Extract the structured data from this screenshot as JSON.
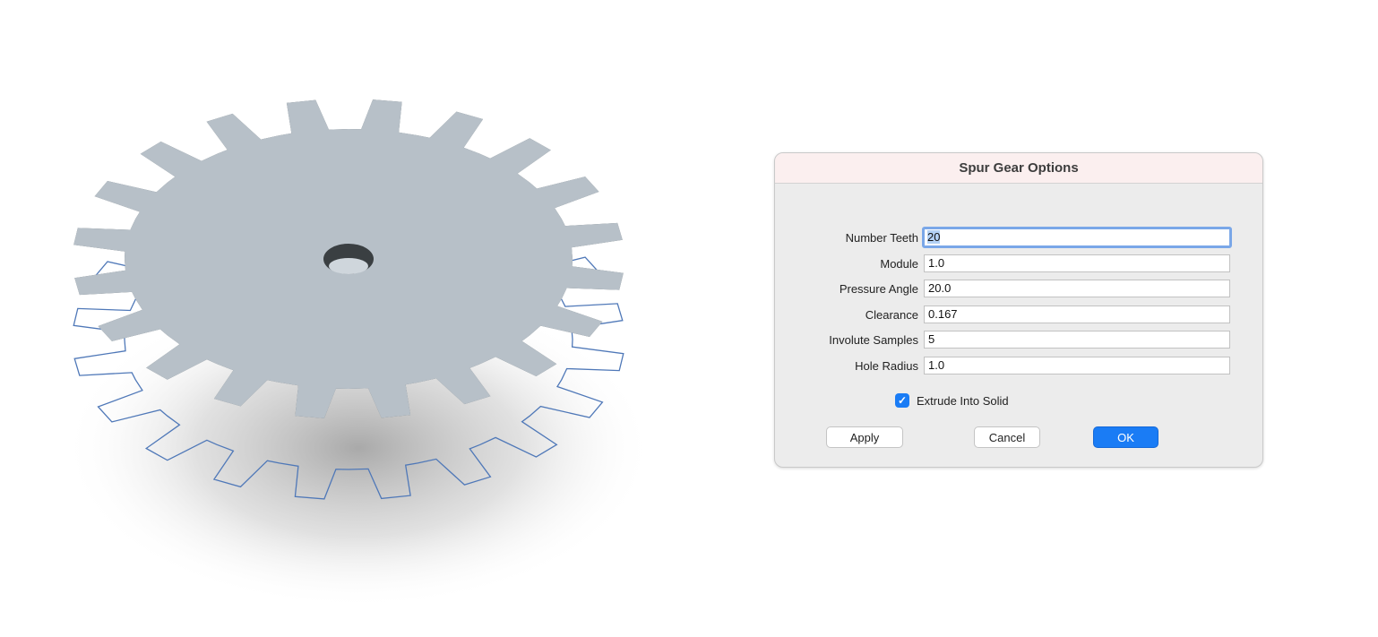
{
  "dialog": {
    "title": "Spur Gear Options",
    "fields": [
      {
        "label": "Number Teeth",
        "value": "20"
      },
      {
        "label": "Module",
        "value": "1.0"
      },
      {
        "label": "Pressure Angle",
        "value": "20.0"
      },
      {
        "label": "Clearance",
        "value": "0.167"
      },
      {
        "label": "Involute Samples",
        "value": "5"
      },
      {
        "label": "Hole Radius",
        "value": "1.0"
      }
    ],
    "extrude": {
      "label": "Extrude Into Solid",
      "checked": true
    },
    "buttons": {
      "apply": "Apply",
      "cancel": "Cancel",
      "ok": "OK"
    }
  },
  "viewport": {
    "gear_teeth": 20,
    "gear_color": "#b7c0c8",
    "gear_side_color": "#5f6669",
    "outline_color": "#4f78b8"
  },
  "colors": {
    "accent": "#1a7cf5"
  }
}
